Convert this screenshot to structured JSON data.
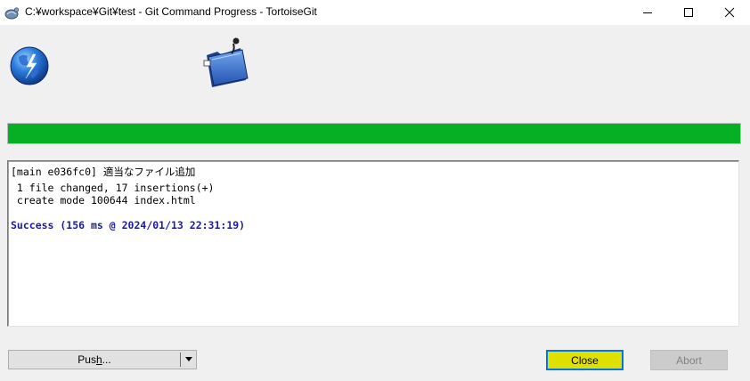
{
  "window": {
    "title": "C:¥workspace¥Git¥test - Git Command Progress - TortoiseGit"
  },
  "progress": {
    "fraction": 1.0,
    "color": "#06b025"
  },
  "log": {
    "lines": [
      "[main e036fc0] 適当なファイル追加",
      " 1 file changed, 17 insertions(+)",
      " create mode 100644 index.html"
    ],
    "success": "Success (156 ms @ 2024/01/13 22:31:19)",
    "success_color": "#1a1aaa"
  },
  "buttons": {
    "push_pre": "Pus",
    "push_accel": "h",
    "push_post": "...",
    "close": "Close",
    "abort": "Abort"
  },
  "icons": {
    "app": "tortoisegit-icon",
    "globe": "globe-icon",
    "folder": "folder-icon",
    "minimize": "minimize-icon",
    "maximize": "maximize-icon",
    "close": "close-icon",
    "dropdown": "chevron-down-icon"
  }
}
